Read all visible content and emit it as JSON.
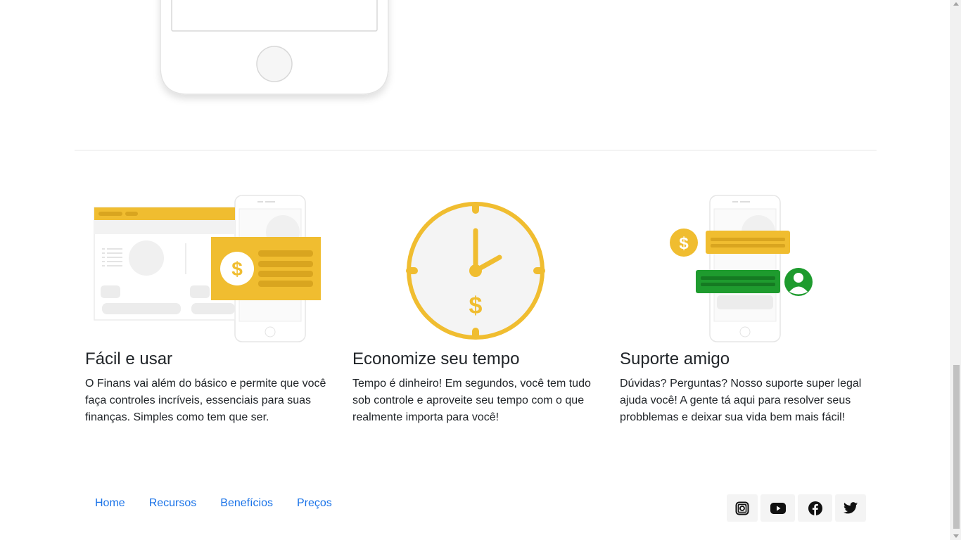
{
  "features": [
    {
      "title": "Fácil e usar",
      "text": "O Finans vai além do básico e permite que você faça controles incríveis, essenciais para suas finanças. Simples como tem que ser.",
      "illustration_icon": "dashboard-card-icon"
    },
    {
      "title": "Economize seu tempo",
      "text": "Tempo é dinheiro! Em segundos, você tem tudo sob controle e aproveite seu tempo com o que realmente importa para você!",
      "illustration_icon": "clock-dollar-icon"
    },
    {
      "title": "Suporte amigo",
      "text": "Dúvidas? Perguntas? Nosso suporte super legal ajuda você! A gente tá aqui para resolver seus probblemas e deixar sua vida bem mais fácil!",
      "illustration_icon": "chat-support-icon"
    }
  ],
  "footer": {
    "nav": [
      "Home",
      "Recursos",
      "Benefícios",
      "Preços"
    ],
    "social_icons": [
      "instagram-icon",
      "youtube-icon",
      "facebook-icon",
      "twitter-icon"
    ]
  },
  "colors": {
    "accent_yellow": "#f0bd30",
    "green": "#1e9b2e",
    "link_blue": "#1a73e8",
    "light_gray": "#eeeeee"
  }
}
